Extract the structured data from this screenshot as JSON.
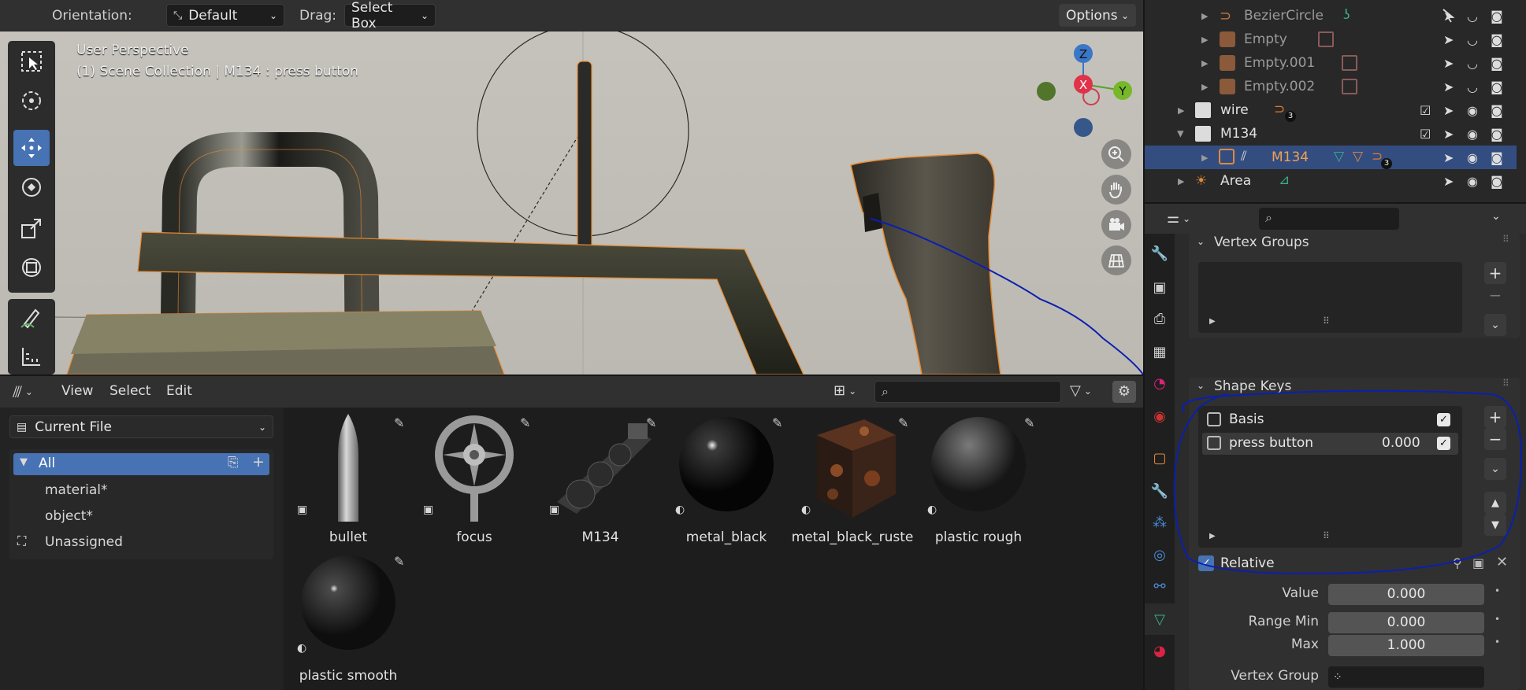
{
  "viewport": {
    "header": {
      "orientation_label": "Orientation:",
      "orientation_value": "Default",
      "drag_label": "Drag:",
      "drag_value": "Select Box",
      "options_label": "Options"
    },
    "overlay_line1": "User Perspective",
    "overlay_line2": "(1) Scene Collection | M134 : press button",
    "gizmo": {
      "z": "Z",
      "x": "X",
      "y": "Y"
    }
  },
  "outliner": {
    "rows": [
      {
        "name": "BezierCircle"
      },
      {
        "name": "Empty"
      },
      {
        "name": "Empty.001"
      },
      {
        "name": "Empty.002"
      },
      {
        "name": "wire",
        "badge": "3"
      },
      {
        "name": "M134"
      },
      {
        "name": "M134",
        "badge": "3"
      },
      {
        "name": "Area"
      }
    ]
  },
  "asset_browser": {
    "menus": [
      "View",
      "Select",
      "Edit"
    ],
    "library": "Current File",
    "catalogs": [
      "All",
      "material*",
      "object*",
      "Unassigned"
    ],
    "assets": [
      {
        "label": "bullet"
      },
      {
        "label": "focus"
      },
      {
        "label": "M134"
      },
      {
        "label": "metal_black"
      },
      {
        "label": "metal_black_ruste"
      },
      {
        "label": "plastic rough"
      },
      {
        "label": "plastic smooth"
      }
    ]
  },
  "properties": {
    "vertex_groups_title": "Vertex Groups",
    "shape_keys_title": "Shape Keys",
    "shape_keys": [
      {
        "name": "Basis",
        "value": ""
      },
      {
        "name": "press button",
        "value": "0.000"
      }
    ],
    "relative_label": "Relative",
    "value_label": "Value",
    "value": "0.000",
    "range_min_label": "Range Min",
    "range_min": "0.000",
    "max_label": "Max",
    "max": "1.000",
    "vertex_group_label": "Vertex Group"
  },
  "colors": {
    "accent": "#4772b3",
    "selection": "#334d80",
    "annotation": "#0a1fb0",
    "outline": "#e88a2e"
  }
}
